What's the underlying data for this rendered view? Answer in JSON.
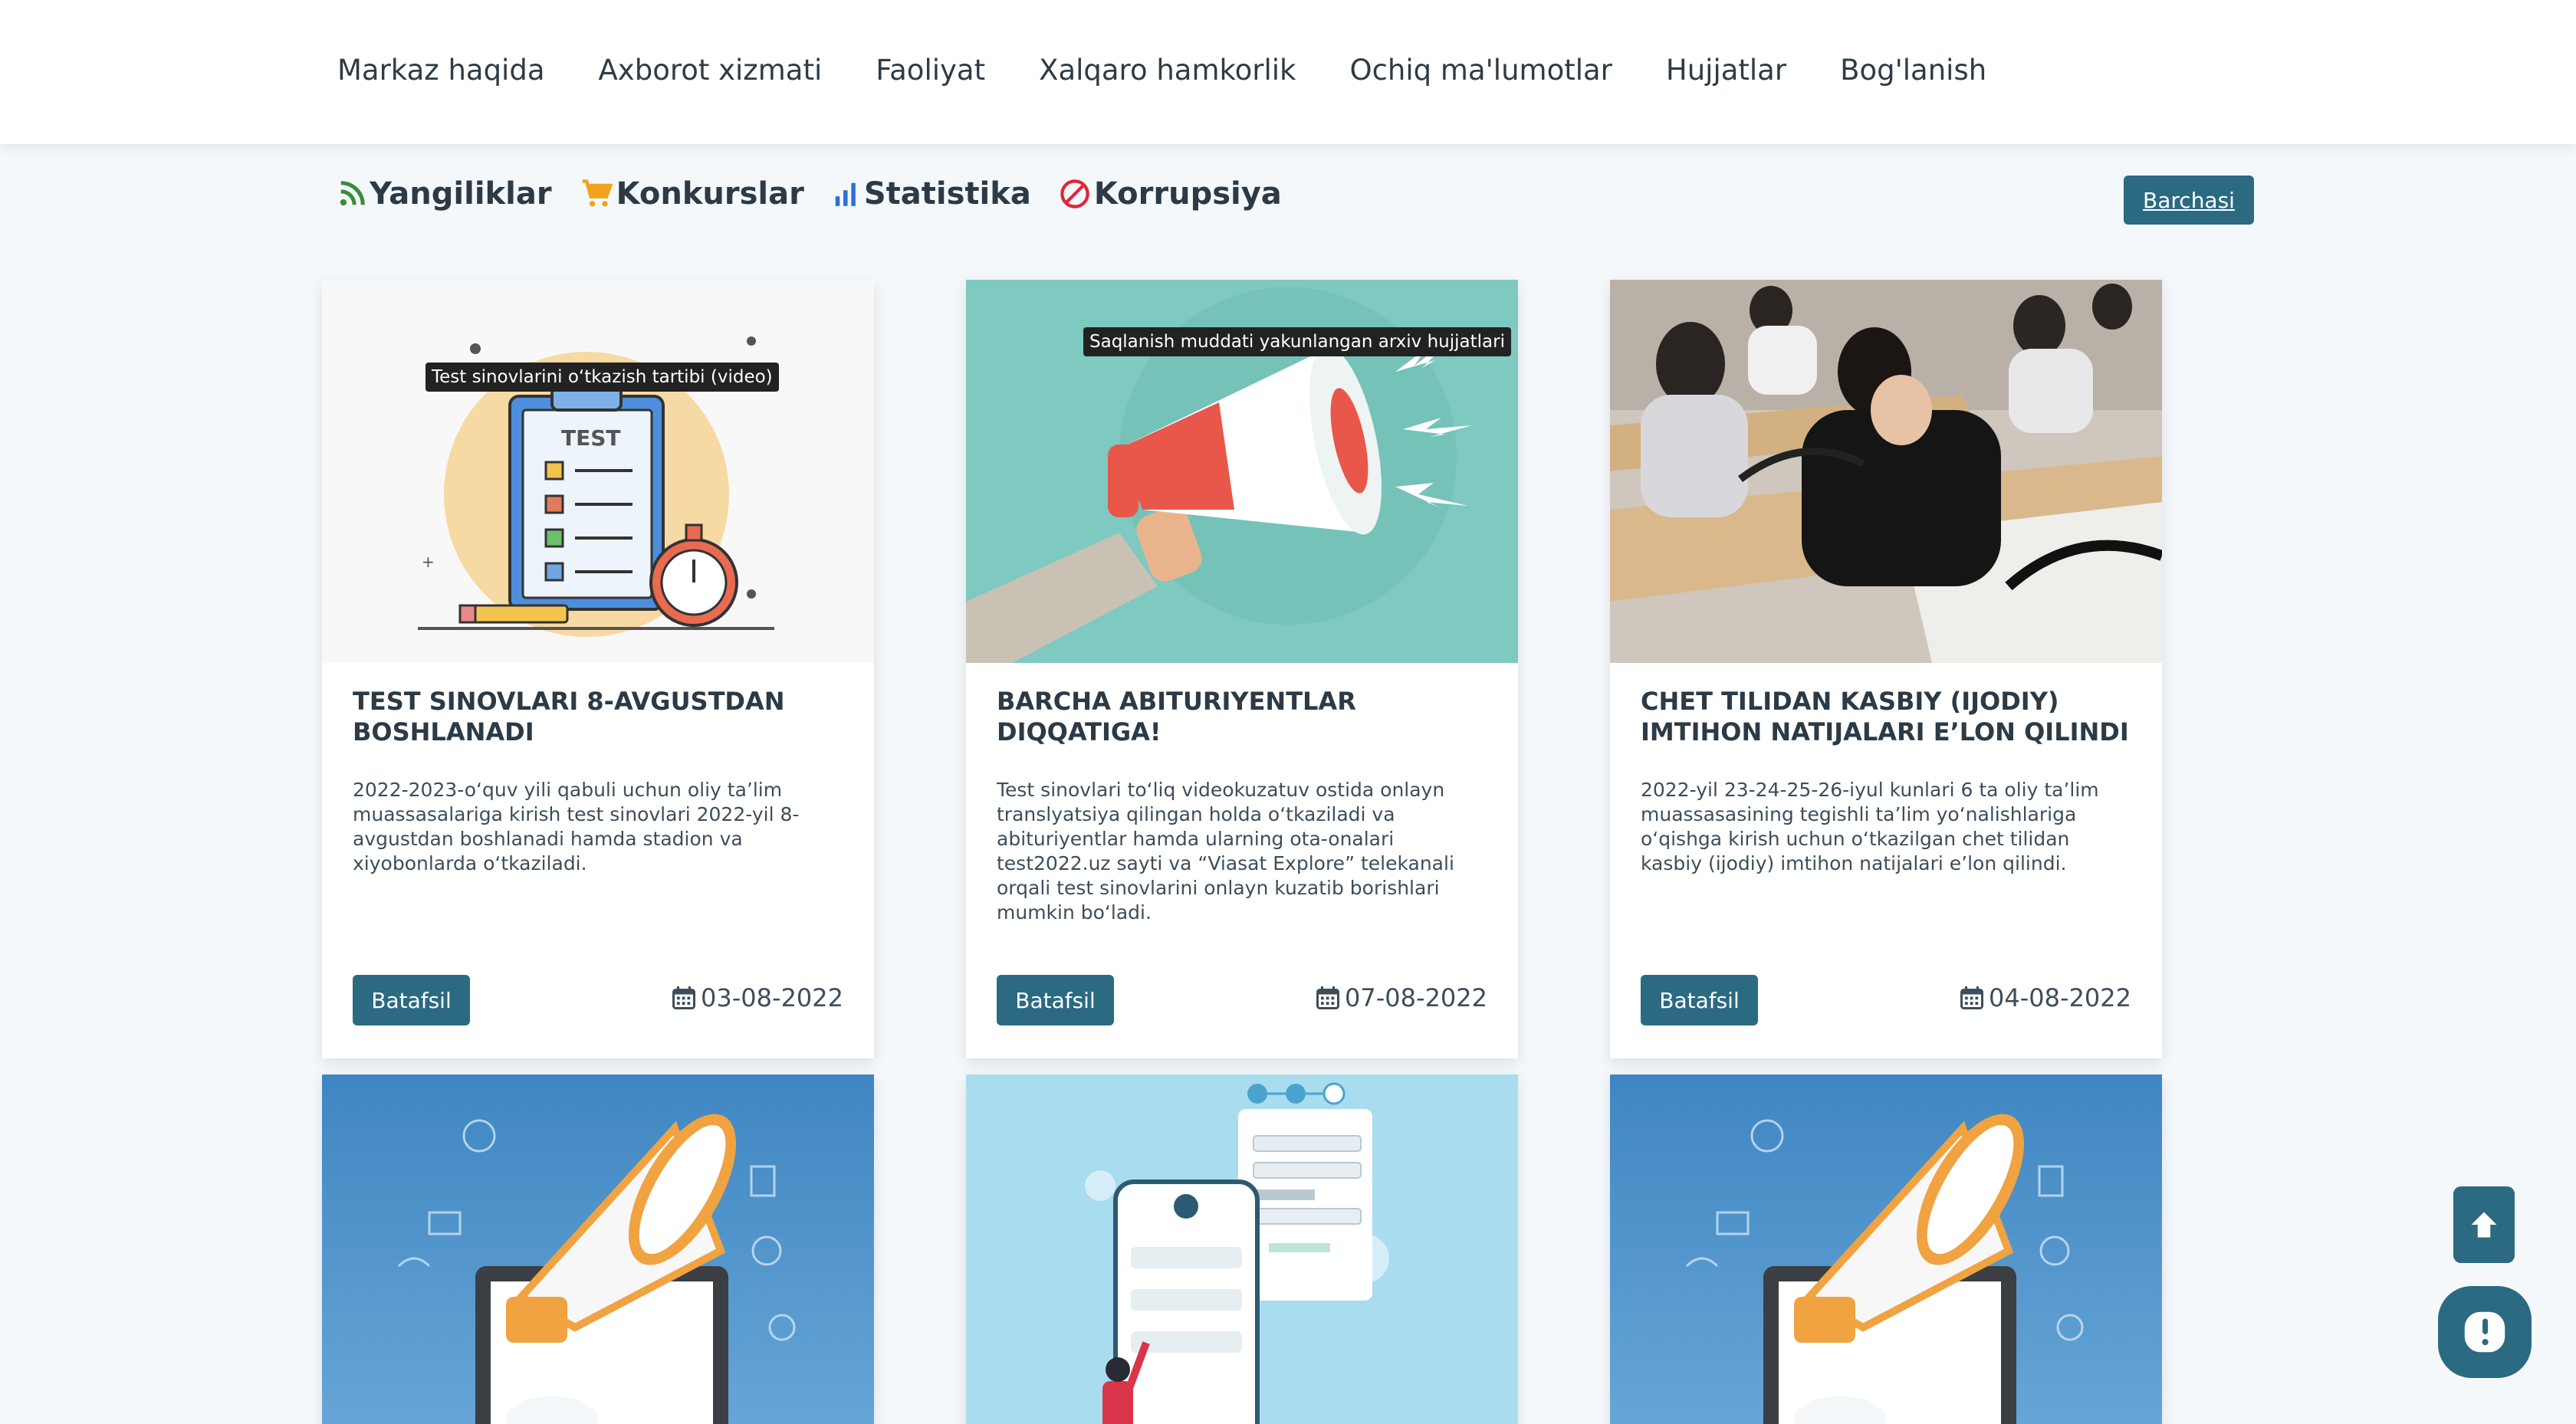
{
  "nav": {
    "items": [
      "Markaz haqida",
      "Axborot xizmati",
      "Faoliyat",
      "Xalqaro hamkorlik",
      "Ochiq ma'lumotlar",
      "Hujjatlar",
      "Bog'lanish"
    ]
  },
  "tabs": {
    "items": [
      {
        "label": "Yangiliklar",
        "icon": "rss-icon",
        "color": "#3a8c3a"
      },
      {
        "label": "Konkurslar",
        "icon": "cart-icon",
        "color": "#f2a31b"
      },
      {
        "label": "Statistika",
        "icon": "bar-chart-icon",
        "color": "#2f6fd6"
      },
      {
        "label": "Korrupsiya",
        "icon": "prohibited-icon",
        "color": "#e0253a"
      }
    ],
    "all_label": "Barchasi"
  },
  "cards": [
    {
      "image_caption": "Test sinovlarini o‘tkazish tartibi (video)",
      "title": "TEST SINOVLARI 8-AVGUSTDAN BOSHLANADI",
      "description": "2022-2023-o‘quv yili qabuli uchun oliy ta’lim muassasalariga kirish test sinovlari 2022-yil 8-avgustdan boshlanadi hamda stadion va xiyobonlarda o‘tkaziladi.",
      "button": "Batafsil",
      "date": "03-08-2022"
    },
    {
      "image_caption": "Saqlanish muddati yakunlangan arxiv hujjatlari",
      "title": "BARCHA ABITURIYENTLAR DIQQATIGA!",
      "description": "Test sinovlari to‘liq videokuzatuv ostida onlayn translyatsiya qilingan holda o‘tkaziladi va abituriyentlar hamda ularning ota-onalari test2022.uz sayti va “Viasat Explore” telekanali orqali test sinovlarini onlayn kuzatib borishlari mumkin bo‘ladi.",
      "button": "Batafsil",
      "date": "07-08-2022"
    },
    {
      "title": "CHET TILIDAN KASBIY (IJODIY) IMTIHON NATIJALARI E’LON QILINDI",
      "description": "2022-yil 23-24-25-26-iyul kunlari 6 ta oliy ta’lim muassasasining tegishli ta’lim yo‘nalishlariga o‘qishga kirish uchun o‘tkazilgan chet tilidan kasbiy (ijodiy) imtihon natijalari e’lon qilindi.",
      "button": "Batafsil",
      "date": "04-08-2022"
    }
  ],
  "bottom_cards": [
    {
      "image": "megaphone-laptop-illustration"
    },
    {
      "image": "phone-form-illustration"
    },
    {
      "image": "megaphone-laptop-illustration"
    }
  ],
  "fab": {
    "up": "arrow-up-icon",
    "chat": "chat-icon"
  }
}
